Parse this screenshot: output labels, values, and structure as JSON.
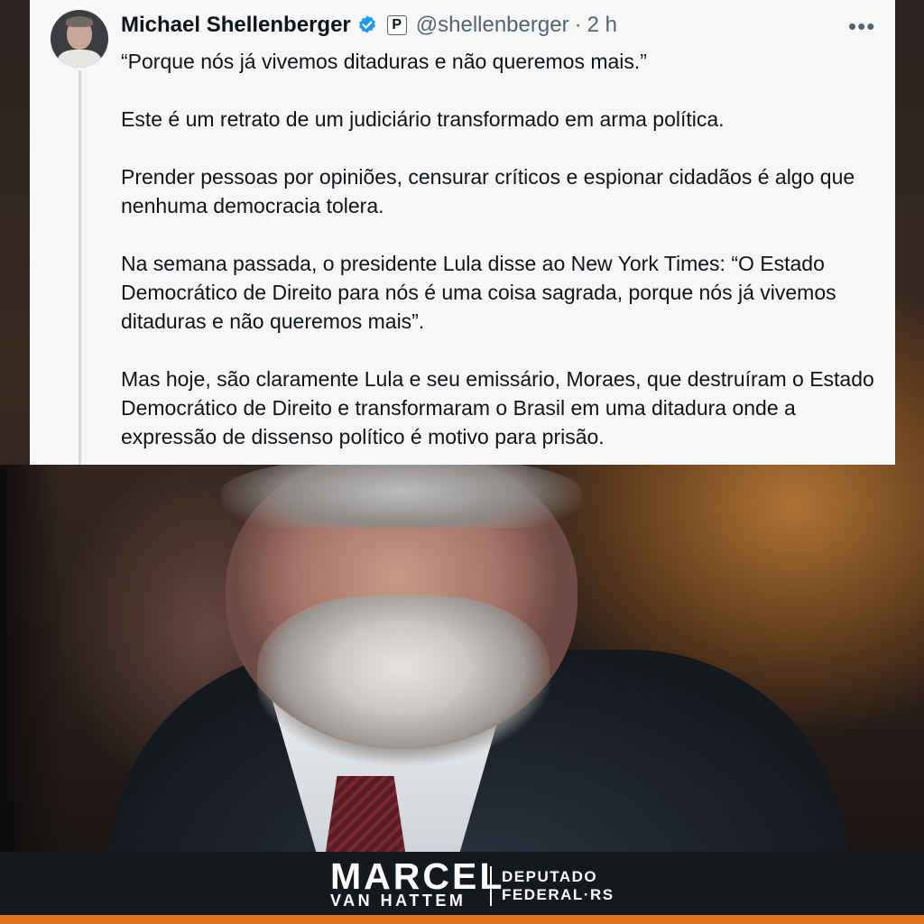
{
  "tweet": {
    "author_name": "Michael Shellenberger",
    "badge": "P",
    "handle": "@shellenberger",
    "separator": "·",
    "time": "2 h",
    "more": "•••",
    "paragraphs": [
      "“Porque nós já vivemos ditaduras e não queremos mais.”",
      "Este é um retrato de um judiciário transformado em arma política.",
      "Prender pessoas por opiniões, censurar críticos e espionar cidadãos é algo que nenhuma democracia tolera.",
      "Na semana passada, o presidente Lula disse ao New York Times: “O Estado Democrático de Direito para nós é uma coisa sagrada, porque nós já vivemos ditaduras e não queremos mais”.",
      "Mas hoje, são claramente Lula e seu emissário, Moraes, que destruíram o Estado Democrático de Direito e transformaram o Brasil em uma ditadura onde a expressão de dissenso político é motivo para prisão."
    ]
  },
  "branding": {
    "name": "MARCEL",
    "surname": "VAN HATTEM",
    "title_line1": "DEPUTADO",
    "title_line2": "FEDERAL·RS"
  },
  "colors": {
    "verified": "#1d9bf0",
    "accent_strip": "#e1731a",
    "card_bg": "#f7f7f7"
  },
  "icons": [
    "verified-badge-icon",
    "more-options-icon",
    "avatar"
  ]
}
